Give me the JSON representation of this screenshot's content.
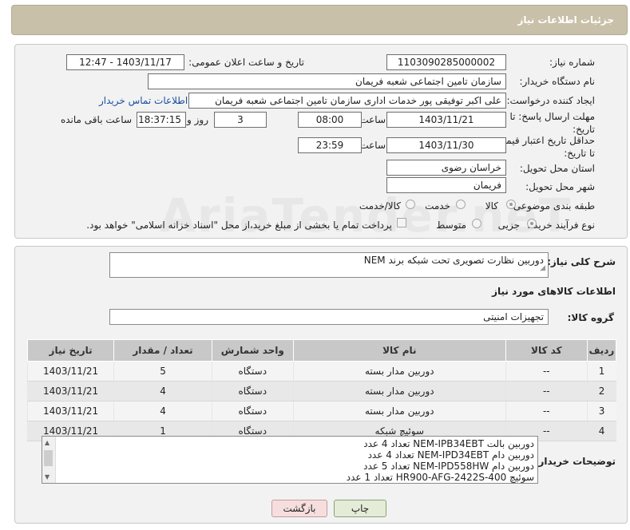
{
  "header": {
    "title": "جزئیات اطلاعات نیاز"
  },
  "form": {
    "need_number_label": "شماره نیاز:",
    "need_number": "1103090285000002",
    "announce_label": "تاریخ و ساعت اعلان عمومی:",
    "announce_value": "1403/11/17 - 12:47",
    "buyer_org_label": "نام دستگاه خریدار:",
    "buyer_org": "سازمان تامین اجتماعی شعبه فریمان",
    "requester_label": "ایجاد کننده درخواست:",
    "requester": "علی اکبر توفیقی پور خدمات اداری سازمان تامین اجتماعی شعبه فریمان",
    "contact_link": "اطلاعات تماس خریدار",
    "send_deadline_label": "مهلت ارسال پاسخ: تا تاریخ:",
    "send_deadline_date": "1403/11/21",
    "time_label": "ساعت",
    "send_deadline_time": "08:00",
    "days_count": "3",
    "days_and_label": "روز و",
    "remaining_time": "18:37:15",
    "remaining_label": "ساعت باقی مانده",
    "price_valid_label": "حداقل تاریخ اعتبار قیمت: تا تاریخ:",
    "price_valid_date": "1403/11/30",
    "price_valid_time": "23:59",
    "province_label": "استان محل تحویل:",
    "province": "خراسان رضوی",
    "city_label": "شهر محل تحویل:",
    "city": "فریمان",
    "category_label": "طبقه بندی موضوعی:",
    "category_options": [
      "کالا",
      "خدمت",
      "کالا/خدمت"
    ],
    "purchase_type_label": "نوع فرآیند خرید :",
    "purchase_type_options": [
      "جزیی",
      "متوسط"
    ],
    "payment_note": "پرداخت تمام یا بخشی از مبلغ خرید،از محل \"اسناد خزانه اسلامی\" خواهد بود."
  },
  "details": {
    "description_label": "شرح کلی نیاز:",
    "description": "دوربین نظارت تصویری تحت شبکه برند NEM",
    "goods_info_title": "اطلاعات کالاهای مورد نیاز",
    "goods_group_label": "گروه کالا:",
    "goods_group": "تجهیزات امنیتی"
  },
  "table": {
    "headers": [
      "ردیف",
      "کد کالا",
      "نام کالا",
      "واحد شمارش",
      "تعداد / مقدار",
      "تاریخ نیاز"
    ],
    "rows": [
      [
        "1",
        "--",
        "دوربین مدار بسته",
        "دستگاه",
        "5",
        "1403/11/21"
      ],
      [
        "2",
        "--",
        "دوربین مدار بسته",
        "دستگاه",
        "4",
        "1403/11/21"
      ],
      [
        "3",
        "--",
        "دوربین مدار بسته",
        "دستگاه",
        "4",
        "1403/11/21"
      ],
      [
        "4",
        "--",
        "سوئیچ شبکه",
        "دستگاه",
        "1",
        "1403/11/21"
      ]
    ]
  },
  "buyer_notes": {
    "label": "توضیحات خریدار:",
    "lines": [
      "دوربین بالت  NEM-IPB34EBT تعداد 4 عدد",
      "دوربین دام NEM-IPD34EBT تعداد 4 عدد",
      "دوربین دام NEM-IPD558HW تعداد 5 عدد",
      "سوئیچ HR900-AFG-2422S-400 تعداد 1 عدد"
    ]
  },
  "buttons": {
    "print": "چاپ",
    "back": "بازگشت"
  },
  "watermark": "AriaTender.neT"
}
